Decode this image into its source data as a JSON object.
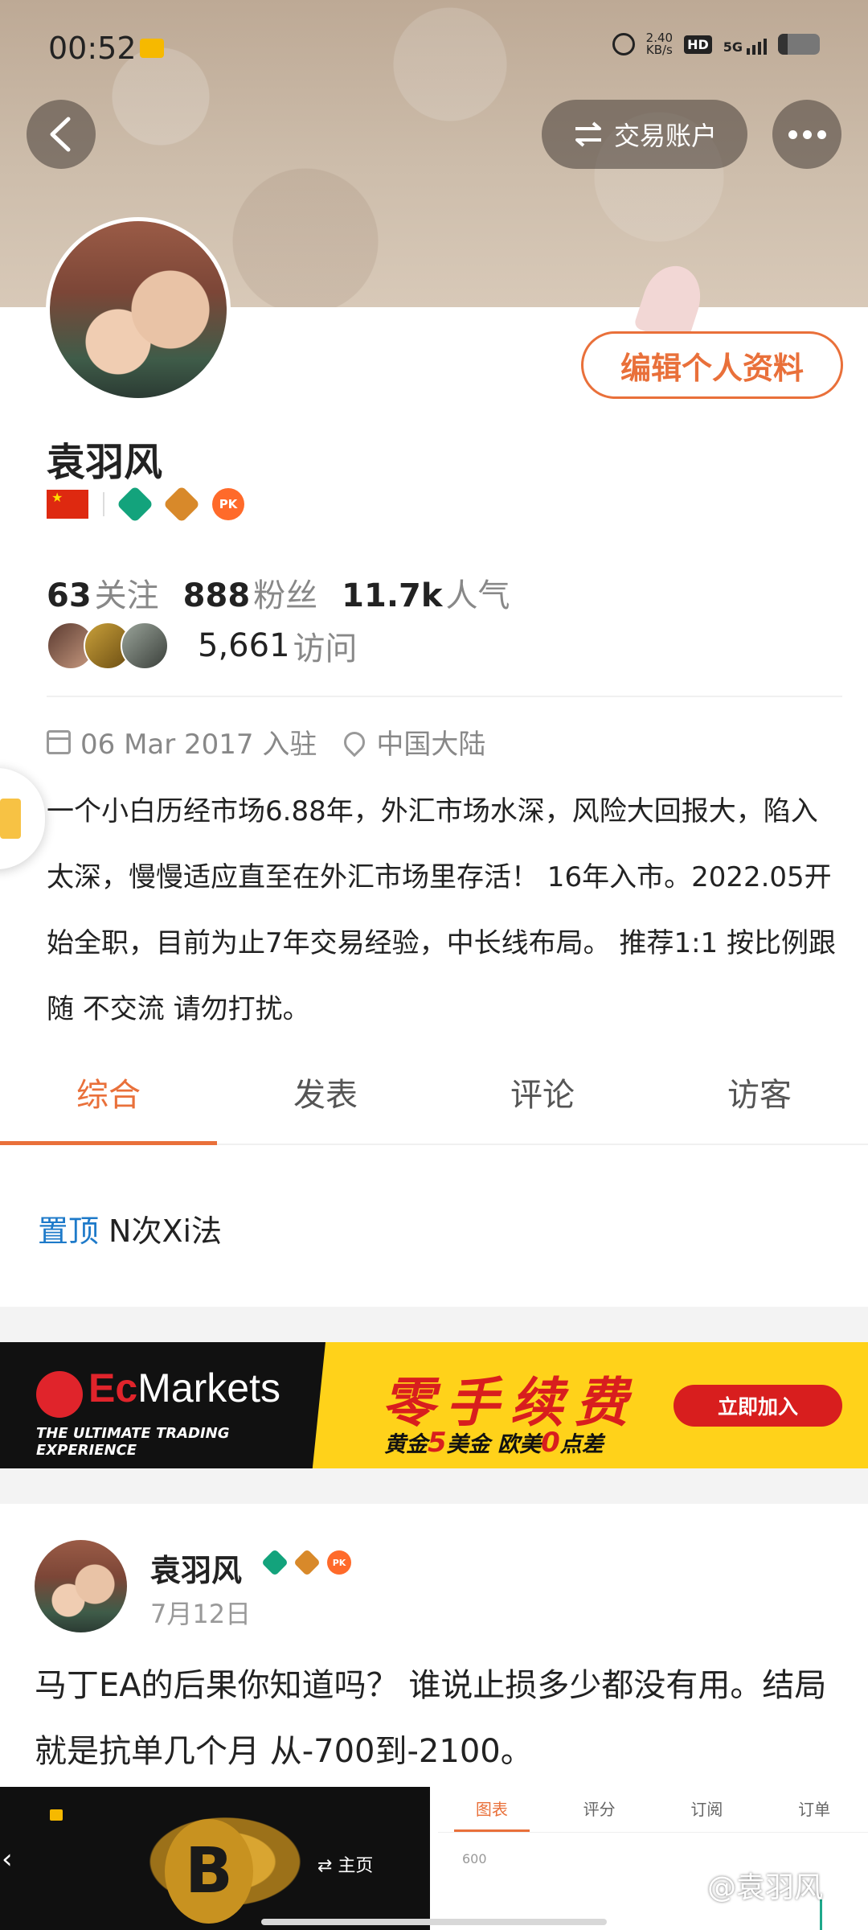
{
  "status_bar": {
    "time": "00:52",
    "speed_value": "2.40",
    "speed_unit": "KB/s",
    "hd": "HD",
    "network": "5G"
  },
  "header": {
    "trade_account_label": "交易账户"
  },
  "profile": {
    "edit_button": "编辑个人资料",
    "name": "袁羽风",
    "pk_badge": "PK",
    "following_count": "63",
    "following_label": "关注",
    "fans_count": "888",
    "fans_label": "粉丝",
    "popularity_count": "11.7k",
    "popularity_label": "人气",
    "visits_count": "5,661",
    "visits_label": "访问",
    "join_date": "06 Mar 2017 入驻",
    "location": "中国大陆",
    "bio": "一个小白历经市场6.88年，外汇市场水深，风险大回报大，陷入太深，慢慢适应直至在外汇市场里存活！ 16年入市。2022.05开始全职，目前为止7年交易经验，中长线布局。 推荐1:1 按比例跟随 不交流 请勿打扰。"
  },
  "tabs": [
    {
      "label": "综合",
      "active": true
    },
    {
      "label": "发表",
      "active": false
    },
    {
      "label": "评论",
      "active": false
    },
    {
      "label": "访客",
      "active": false
    }
  ],
  "pinned": {
    "tag": "置顶",
    "title": "N次Xi法"
  },
  "ad": {
    "brand_prefix": "Ec",
    "brand_suffix": "Markets",
    "tagline": "THE ULTIMATE TRADING EXPERIENCE",
    "headline": "零手续费",
    "sub_a": "黄金",
    "sub_num1": "5",
    "sub_b": "美金 欧美",
    "sub_num2": "0",
    "sub_c": "点差",
    "cta": "立即加入"
  },
  "post": {
    "author": "袁羽风",
    "pk_badge": "PK",
    "date": "7月12日",
    "text": "马丁EA的后果你知道吗？ 谁说止损多少都没有用。结局就是抗单几个月 从-700到-2100。",
    "image_left_home": "⇄ 主页",
    "image_right_tabs": [
      "图表",
      "评分",
      "订阅",
      "订单"
    ],
    "image_right_axis": "600"
  },
  "watermark": "@袁羽风",
  "colors": {
    "accent": "#e9703a",
    "link_blue": "#1e7ac9",
    "ad_yellow": "#ffd21a",
    "ad_red": "#d81e1e"
  }
}
